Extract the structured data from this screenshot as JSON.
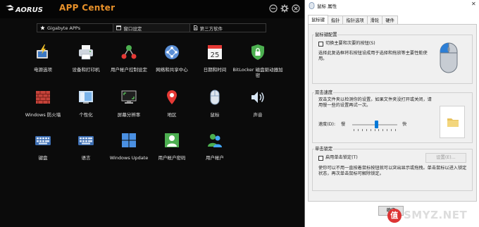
{
  "app": {
    "brand": "AORUS",
    "title": "APP Center"
  },
  "tabs": [
    {
      "label": "Gigabyte APPs",
      "icon": "star-icon"
    },
    {
      "label": "窗口设定",
      "icon": "window-icon"
    },
    {
      "label": "第三方软件",
      "icon": "document-icon"
    }
  ],
  "apps": [
    {
      "label": "电源选项",
      "icon": "power-options-icon"
    },
    {
      "label": "设备和打印机",
      "icon": "printer-icon"
    },
    {
      "label": "用户帐户控制设定",
      "icon": "user-account-control-icon"
    },
    {
      "label": "网络和共享中心",
      "icon": "network-icon"
    },
    {
      "label": "日期和时间",
      "icon": "calendar-icon",
      "day": "25"
    },
    {
      "label": "BitLocker 磁盘驱动器加密",
      "icon": "bitlocker-icon"
    },
    {
      "label": "Windows 防火墙",
      "icon": "firewall-icon"
    },
    {
      "label": "个性化",
      "icon": "personalization-icon"
    },
    {
      "label": "屏幕分辨率",
      "icon": "display-icon"
    },
    {
      "label": "地区",
      "icon": "location-icon"
    },
    {
      "label": "鼠标",
      "icon": "mouse-icon"
    },
    {
      "label": "声音",
      "icon": "sound-icon"
    },
    {
      "label": "键盘",
      "icon": "keyboard-icon"
    },
    {
      "label": "语言",
      "icon": "language-icon"
    },
    {
      "label": "Windows Update",
      "icon": "windows-update-icon"
    },
    {
      "label": "用户帐户密码",
      "icon": "user-password-icon"
    },
    {
      "label": "用户帐户",
      "icon": "user-accounts-icon"
    }
  ],
  "dialog": {
    "title": "鼠标 属性",
    "tabs": [
      "鼠标键",
      "指针",
      "指针选项",
      "滑轮",
      "硬件"
    ],
    "buttons_group": {
      "title": "鼠标键配置",
      "checkbox_label": "切换主要和次要的按钮(S)",
      "checked": false,
      "description": "选择此复选框将右按钮设成用于选择和拖放等主要性能使用。"
    },
    "speed_group": {
      "title": "双击速度",
      "description": "双击文件夹以检测你的设置。如果文件夹没打开或关闭，请用慢一些的设置再试一次。",
      "speed_label": "速度(D):",
      "slow": "慢",
      "fast": "快",
      "speed_value": 0.55
    },
    "clicklock_group": {
      "title": "单击锁定",
      "checkbox_label": "启用单击锁定(T)",
      "checked": false,
      "settings_button": "设置(E)...",
      "description": "使你可以不用一直按着鼠标按钮就可以突出显示或拖拽。单击鼠标以进入锁定状态，再次单击鼠标可解除锁定。"
    },
    "ok_button": "确定"
  },
  "watermark": "SMYZ.NET",
  "watermark_mark": "值"
}
